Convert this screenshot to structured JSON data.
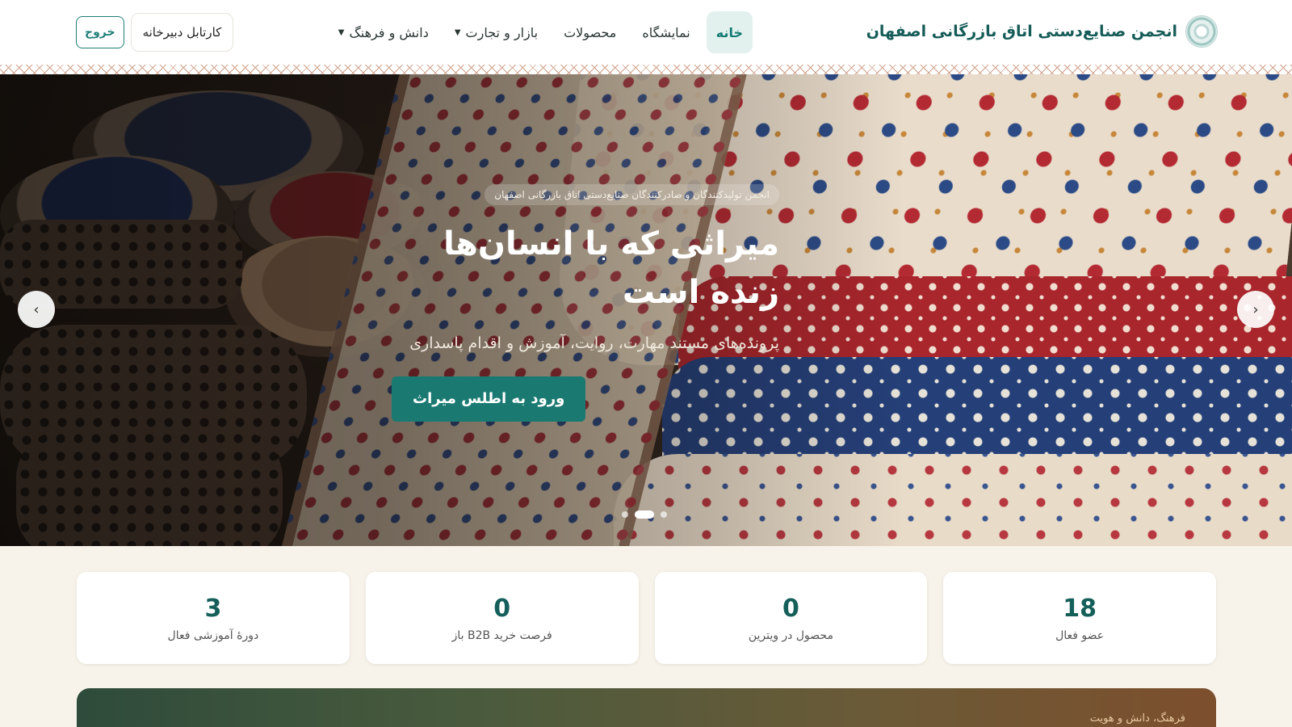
{
  "brand": {
    "name": "انجمن صنایع‌دستی اتاق بازرگانی اصفهان",
    "logo_icon": "emblem-icon"
  },
  "nav": {
    "items": [
      {
        "label": "خانه",
        "active": true
      },
      {
        "label": "نمایشگاه"
      },
      {
        "label": "محصولات"
      },
      {
        "label": "بازار و تجارت",
        "dropdown": true
      },
      {
        "label": "دانش و فرهنگ",
        "dropdown": true
      }
    ]
  },
  "header_actions": {
    "cartable_label": "کارتابل دبیرخانه",
    "logout_label": "خروج"
  },
  "hero": {
    "kicker": "انجمن تولیدکنندگان و صادرکنندگان صنایع‌دستی اتاق بازرگانی اصفهان",
    "title": "میراثی که با انسان‌ها زنده است",
    "subtitle": "پرونده‌های مستند مهارت، روایت، آموزش و اقدام پاسداری",
    "cta_label": "ورود به اطلس میراث",
    "prev_arrow": "›",
    "next_arrow": "‹",
    "slide_count": 3,
    "active_slide": 2
  },
  "stats": [
    {
      "value": "18",
      "label": "عضو فعال"
    },
    {
      "value": "0",
      "label": "محصول در ویترین"
    },
    {
      "value": "0",
      "label": "فرصت خرید B2B باز"
    },
    {
      "value": "3",
      "label": "دورهٔ آموزشی فعال"
    }
  ],
  "bottom_banner": {
    "kicker": "فرهنگ، دانش و هویت"
  },
  "colors": {
    "primary": "#1a7a72",
    "brand_text": "#155b57",
    "background": "#f7f3ea"
  }
}
